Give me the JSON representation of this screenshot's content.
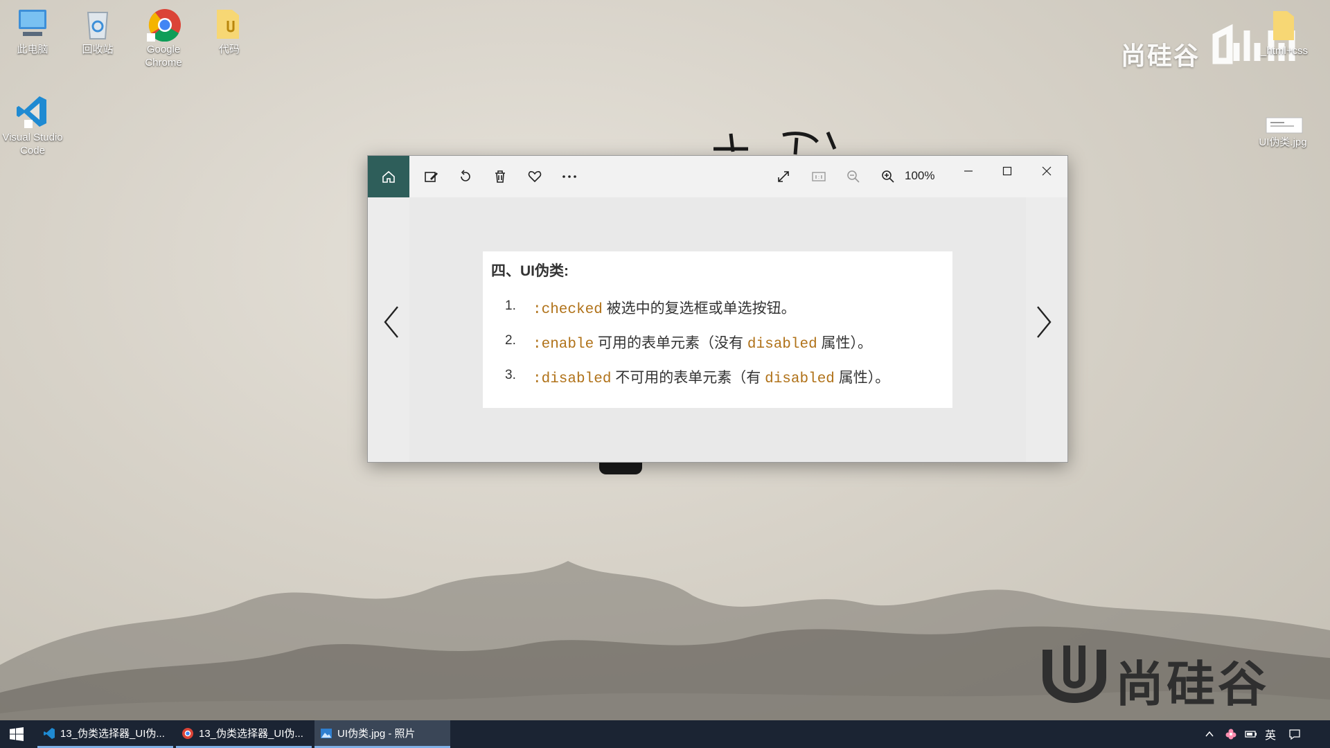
{
  "desktop": {
    "icons": [
      {
        "label": "此电脑",
        "icon": "computer-icon"
      },
      {
        "label": "回收站",
        "icon": "recycle-bin-icon"
      },
      {
        "label": "Google Chrome",
        "icon": "chrome-icon"
      },
      {
        "label": "代码",
        "icon": "folder-icon"
      },
      {
        "label": "Visual Studio Code",
        "icon": "vscode-icon"
      }
    ],
    "right_icons": [
      {
        "label": "_html+css",
        "icon": "folder-icon"
      },
      {
        "label": "UI伪类.jpg",
        "icon": "image-file-icon"
      }
    ],
    "brand_watermark": "尚硅谷",
    "bottom_logo_text": "尚硅谷"
  },
  "photos_window": {
    "zoom_level": "100%",
    "photo": {
      "title": "四、UI伪类:",
      "items": [
        {
          "num": "1.",
          "code": ":checked",
          "text": " 被选中的复选框或单选按钮。"
        },
        {
          "num": "2.",
          "code": ":enable",
          "text": " 可用的表单元素（没有 ",
          "code2": "disabled",
          "text2": " 属性）。"
        },
        {
          "num": "3.",
          "code": ":disabled",
          "text": " 不可用的表单元素（有 ",
          "code2": "disabled",
          "text2": " 属性）。"
        }
      ]
    }
  },
  "taskbar": {
    "tasks": [
      {
        "label": "13_伪类选择器_UI伪...",
        "icon": "vscode-icon"
      },
      {
        "label": "13_伪类选择器_UI伪...",
        "icon": "chrome-icon"
      },
      {
        "label": "UI伪类.jpg - 照片",
        "icon": "photos-icon"
      }
    ],
    "ime_label": "英"
  },
  "colors": {
    "accent_home": "#2e5e5a",
    "code_color": "#b07219",
    "taskbar_bg": "#1b2433"
  }
}
